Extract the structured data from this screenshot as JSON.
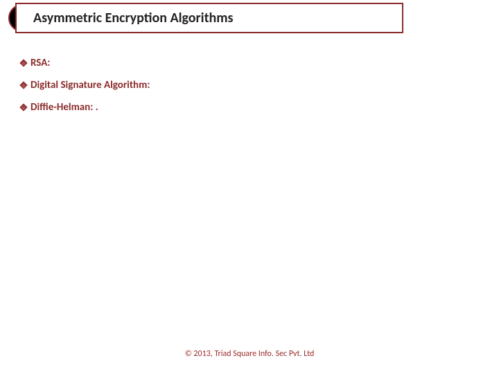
{
  "slide": {
    "title": "Asymmetric Encryption Algorithms",
    "bullets": [
      {
        "label": "RSA:"
      },
      {
        "label": "Digital Signature Algorithm:"
      },
      {
        "label": "Diffie-Helman: ."
      }
    ],
    "footer": "© 2013, Triad Square Info. Sec Pvt. Ltd"
  }
}
